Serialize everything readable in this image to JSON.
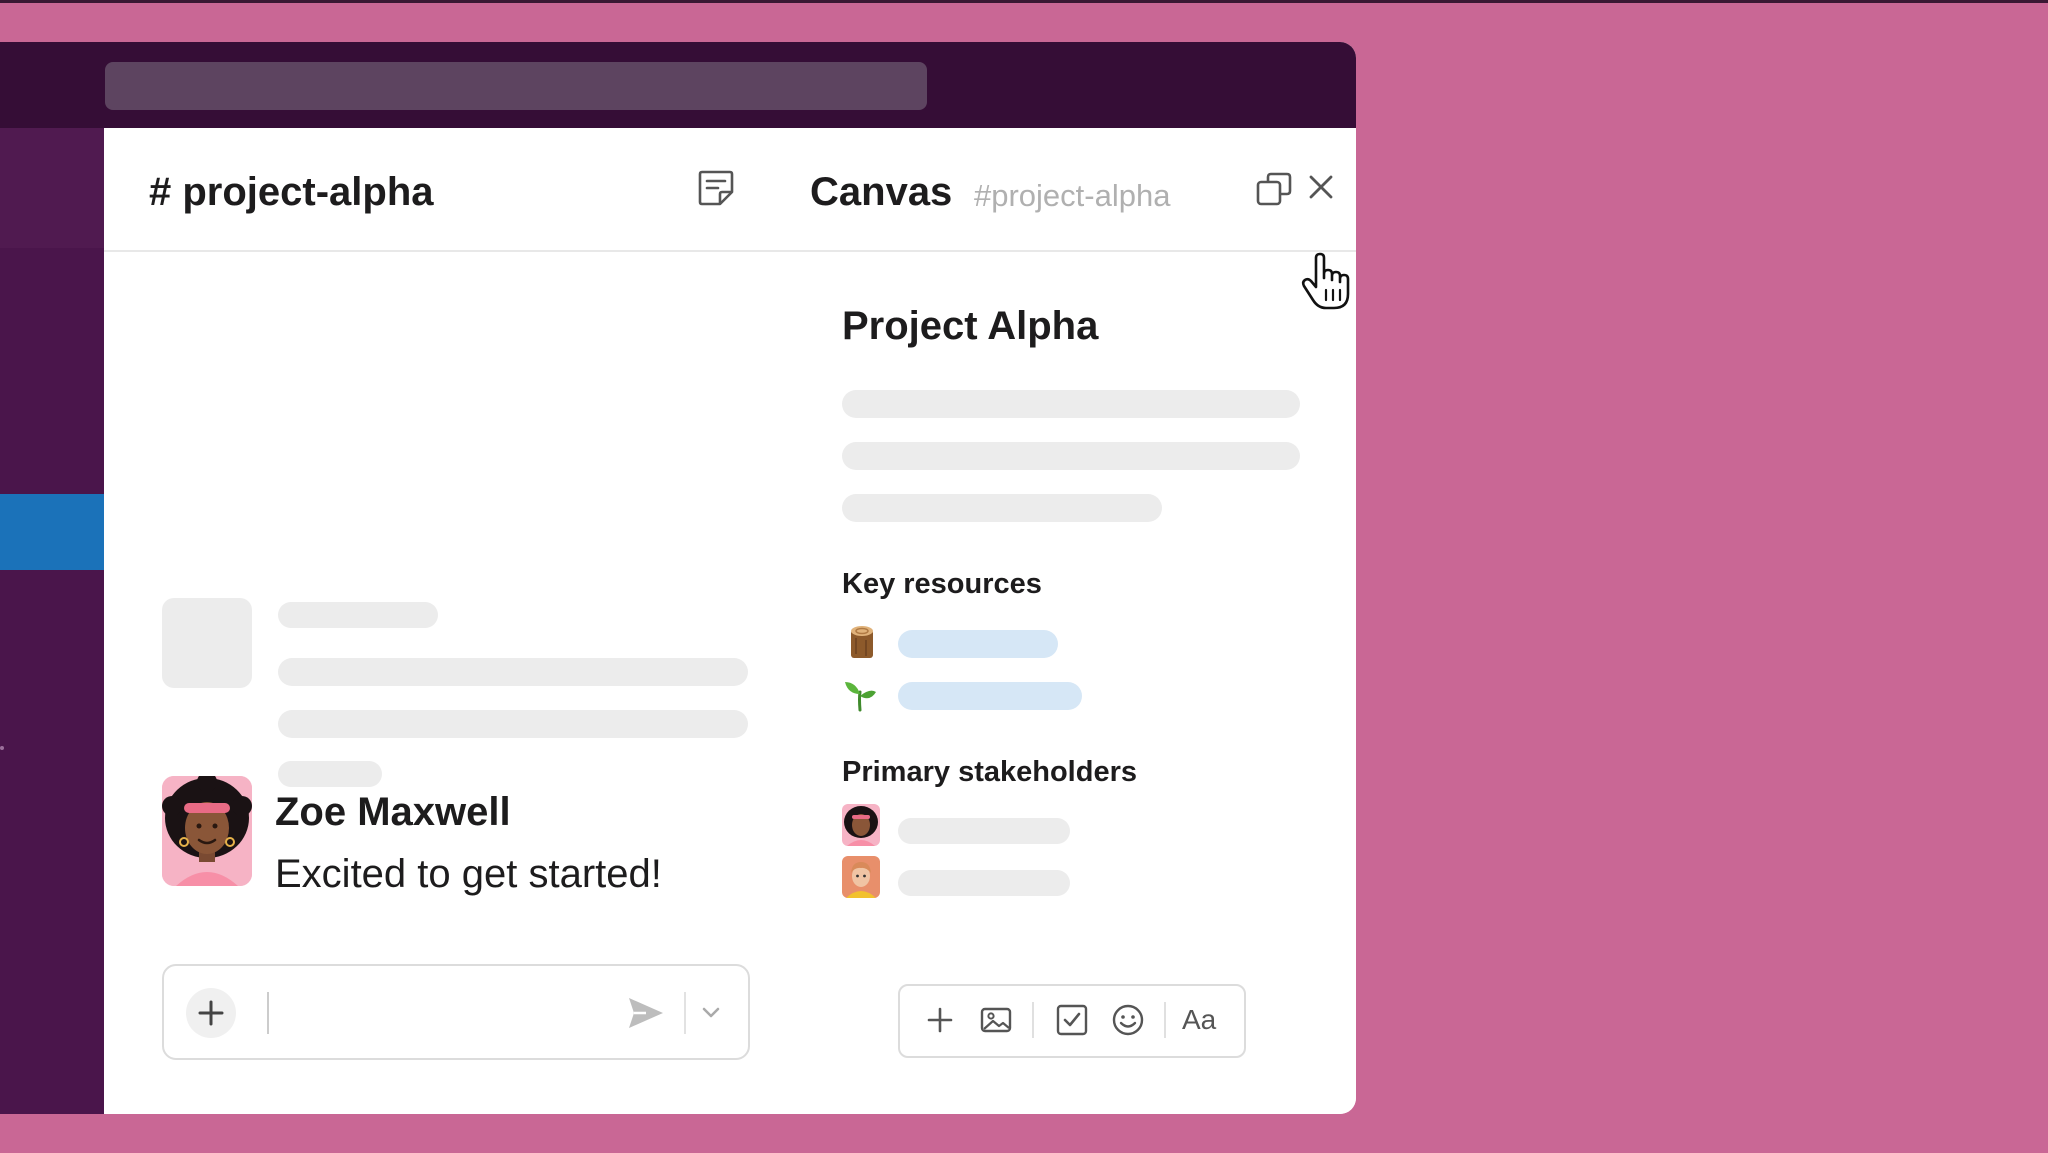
{
  "channel": {
    "name": "# project-alpha"
  },
  "message": {
    "author": "Zoe Maxwell",
    "text": "Excited to get started!"
  },
  "canvas": {
    "title": "Canvas",
    "subtitle": "#project-alpha",
    "doc_title": "Project Alpha",
    "sections": {
      "key_resources": "Key resources",
      "primary_stakeholders": "Primary stakeholders"
    },
    "toolbar": {
      "text_format_label": "Aa"
    }
  },
  "icons": {
    "note": "canvas-note-icon",
    "popout": "popout-window-icon",
    "close": "close-icon",
    "send": "send-icon",
    "plus": "plus-icon",
    "image": "image-icon",
    "checklist": "checkbox-icon",
    "emoji": "emoji-icon",
    "resource_1": "wood-log-emoji",
    "resource_2": "seedling-emoji",
    "cursor": "hand-pointer-cursor"
  },
  "colors": {
    "background": "#c96795",
    "titlebar": "#350d36",
    "sidebar": "#4a154b",
    "active_item": "#1b72b9",
    "link_placeholder": "#d6e7f6"
  }
}
